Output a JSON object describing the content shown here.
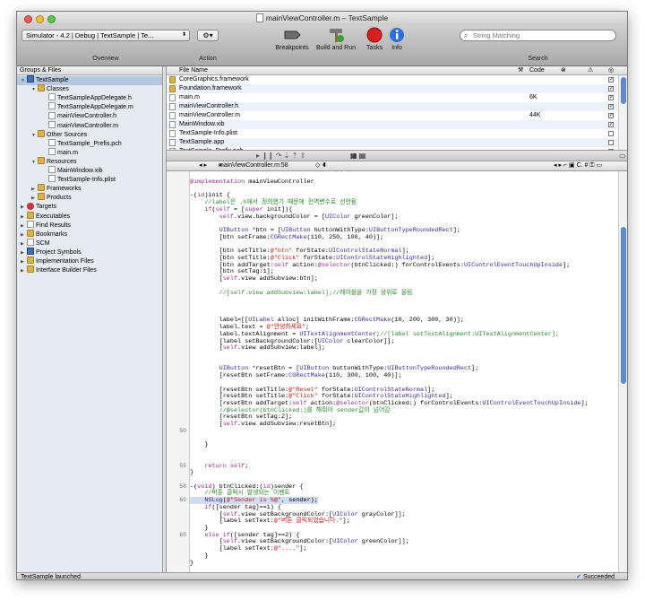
{
  "window": {
    "title": "mainViewController.m – TextSample"
  },
  "toolbar": {
    "overview_value": "Simulator - 4.2 | Debug | TextSample | Te...",
    "overview_label": "Overview",
    "action_label": "Action",
    "breakpoints_label": "Breakpoints",
    "build_run_label": "Build and Run",
    "tasks_label": "Tasks",
    "info_label": "Info",
    "search_placeholder": "String Matching",
    "search_label": "Search"
  },
  "sidebar": {
    "header": "Groups & Files",
    "items": [
      {
        "label": "TextSample",
        "depth": 0,
        "icon": "project-icon",
        "open": true,
        "selected": true
      },
      {
        "label": "Classes",
        "depth": 1,
        "icon": "folder-icon",
        "open": true
      },
      {
        "label": "TextSampleAppDelegate.h",
        "depth": 2,
        "icon": "header-file-icon"
      },
      {
        "label": "TextSampleAppDelegate.m",
        "depth": 2,
        "icon": "source-file-icon"
      },
      {
        "label": "mainViewController.h",
        "depth": 2,
        "icon": "header-file-icon"
      },
      {
        "label": "mainViewController.m",
        "depth": 2,
        "icon": "source-file-icon"
      },
      {
        "label": "Other Sources",
        "depth": 1,
        "icon": "folder-icon",
        "open": true
      },
      {
        "label": "TextSample_Prefix.pch",
        "depth": 2,
        "icon": "header-file-icon"
      },
      {
        "label": "main.m",
        "depth": 2,
        "icon": "source-file-icon"
      },
      {
        "label": "Resources",
        "depth": 1,
        "icon": "folder-icon",
        "open": true
      },
      {
        "label": "MainWindow.xib",
        "depth": 2,
        "icon": "xib-file-icon"
      },
      {
        "label": "TextSample-Info.plist",
        "depth": 2,
        "icon": "plist-file-icon"
      },
      {
        "label": "Frameworks",
        "depth": 1,
        "icon": "folder-icon",
        "open": false
      },
      {
        "label": "Products",
        "depth": 1,
        "icon": "folder-icon",
        "open": false
      },
      {
        "label": "Targets",
        "depth": 0,
        "icon": "target-icon",
        "open": false
      },
      {
        "label": "Executables",
        "depth": 0,
        "icon": "executable-icon",
        "open": false
      },
      {
        "label": "Find Results",
        "depth": 0,
        "icon": "search-icon",
        "open": false
      },
      {
        "label": "Bookmarks",
        "depth": 0,
        "icon": "bookmark-icon",
        "open": false
      },
      {
        "label": "SCM",
        "depth": 0,
        "icon": "scm-icon",
        "open": false
      },
      {
        "label": "Project Symbols",
        "depth": 0,
        "icon": "symbols-icon",
        "open": false
      },
      {
        "label": "Implementation Files",
        "depth": 0,
        "icon": "folder-icon",
        "open": false
      },
      {
        "label": "Interface Builder Files",
        "depth": 0,
        "icon": "folder-icon",
        "open": false
      }
    ]
  },
  "filelist": {
    "columns": {
      "name": "File Name",
      "code": "Code"
    },
    "rows": [
      {
        "name": "CoreGraphics.framework",
        "code": "",
        "checked": true
      },
      {
        "name": "Foundation.framework",
        "code": "",
        "checked": true
      },
      {
        "name": "main.m",
        "code": "6K",
        "checked": true
      },
      {
        "name": "mainViewController.h",
        "code": "",
        "checked": true
      },
      {
        "name": "mainViewController.m",
        "code": "44K",
        "checked": true
      },
      {
        "name": "MainWindow.xib",
        "code": "",
        "checked": true
      },
      {
        "name": "TextSample-Info.plist",
        "code": "",
        "checked": false
      },
      {
        "name": "TextSample.app",
        "code": "",
        "checked": false
      },
      {
        "name": "TextSample_Prefix.pch",
        "code": "",
        "checked": true
      },
      {
        "name": "TextSampleAppDelegate.h",
        "code": "",
        "checked": true
      }
    ]
  },
  "editor": {
    "file_popup": "mainViewController.m:58",
    "function_popup": "-btnClicked:",
    "lines": [
      "@implementation mainViewController",
      "",
      "-(id)init {",
      "    //label은 .h에서 정의했기 때문에 전역변수로 선언됨",
      "    if(self = [super init]){",
      "        self.view.backgroundColor = [UIColor greenColor];",
      "",
      "        UIButton *btn = [UIButton buttonWithType:UIButtonTypeRoundedRect];",
      "        [btn setFrame:CGRectMake(110, 250, 100, 40)];",
      "",
      "        [btn setTitle:@\"btn\" forState:UIControlStateNormal];",
      "        [btn setTitle:@\"Click\" forState:UIControlStateHighlighted];",
      "        [btn addTarget:self action:@selector(btnClicked:) forControlEvents:UIControlEventTouchUpInside];",
      "        [btn setTag:1];",
      "        [self.view addSubview:btn];",
      "",
      "        //[self.view addSubview:label];//레이블을 가장 상위로 올림",
      "",
      "",
      "",
      "        label=[[UILabel alloc] initWithFrame:CGRectMake(10, 200, 300, 30)];",
      "        label.text = @\"안녕하세요\";",
      "        label.textAlignment = UITextAlignmentCenter;//[label setTextAlignment:UITextAlignmentCenter];",
      "        [label setBackgroundColor:[UIColor clearColor]];",
      "        [self.view addSubview:label];",
      "",
      "",
      "        UIButton *resetBtn = [UIButton buttonWithType:UIButtonTypeRoundedRect];",
      "        [resetBtn setFrame:CGRectMake(110, 300, 100, 40)];",
      "",
      "        [resetBtn setTitle:@\"Reset\" forState:UIControlStateNormal];",
      "        [resetBtn setTitle:@\"Click\" forState:UIControlStateHighlighted];",
      "        [resetBtn addTarget:self action:@selector(btnClicked:) forControlEvents:UIControlEventTouchUpInside];",
      "        //@selector(btnClicked:)를 해줘야 sender값이 넘어감",
      "        [resetBtn setTag:2];",
      "        [self.view addSubview:resetBtn];",
      "",
      "",
      "    }",
      "",
      "",
      "    return self;",
      "}",
      "",
      "-(void) btnClicked:(id)sender {",
      "    //버튼 클릭시 발생되는 이벤트",
      "    NSLog(@\"Sender is %@\", sender);",
      "    if([sender tag]==1) {",
      "        [self.view setBackgroundColor:[UIColor grayColor]];",
      "        [label setText:@\"버튼 클릭되었습니다.\"];",
      "    }",
      "    else if([sender tag]==2) {",
      "        [self.view setBackgroundColor:[UIColor greenColor]];",
      "        [label setText:@\"....\"];",
      "    }",
      "}",
      "",
      "}"
    ],
    "gutter_numbers": [
      "50",
      "55",
      "58",
      "60",
      "65"
    ]
  },
  "status": {
    "left": "TextSample launched",
    "right": "Succeeded"
  }
}
